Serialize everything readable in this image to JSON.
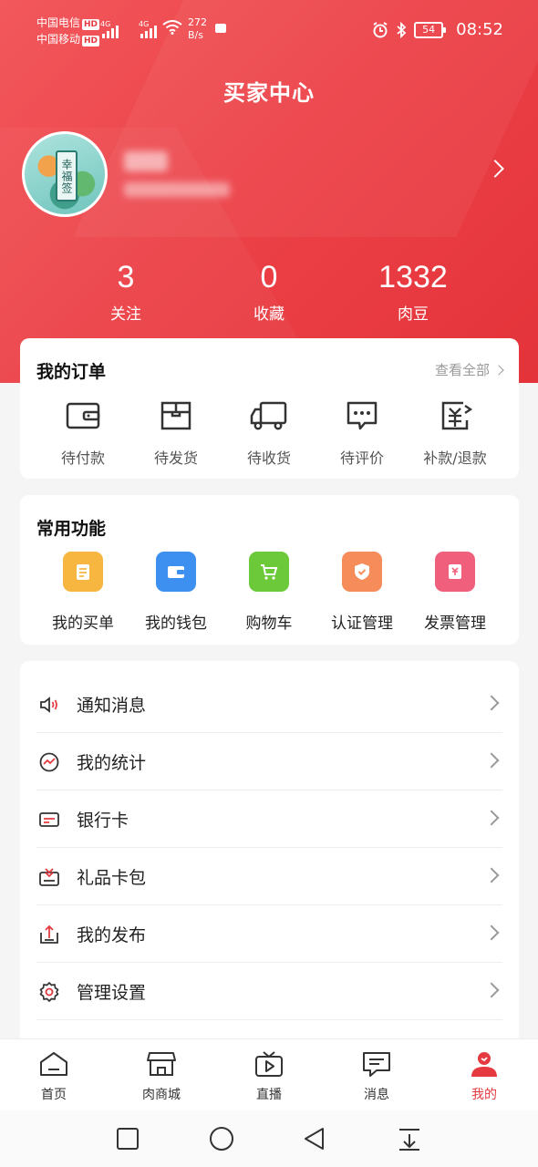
{
  "status_bar": {
    "carrier1": "中国电信",
    "carrier2": "中国移动",
    "hd": "HD",
    "net1": "4G",
    "net2": "4G",
    "speed_value": "272",
    "speed_unit": "B/s",
    "battery": "54",
    "time": "08:52"
  },
  "page": {
    "title": "买家中心"
  },
  "profile": {
    "avatar_text": "幸福签"
  },
  "stats": [
    {
      "value": "3",
      "label": "关注"
    },
    {
      "value": "0",
      "label": "收藏"
    },
    {
      "value": "1332",
      "label": "肉豆"
    }
  ],
  "orders": {
    "title": "我的订单",
    "view_all": "查看全部",
    "items": [
      {
        "label": "待付款",
        "icon": "wallet-icon"
      },
      {
        "label": "待发货",
        "icon": "package-icon"
      },
      {
        "label": "待收货",
        "icon": "truck-icon"
      },
      {
        "label": "待评价",
        "icon": "comment-icon"
      },
      {
        "label": "补款/退款",
        "icon": "refund-icon"
      }
    ]
  },
  "functions": {
    "title": "常用功能",
    "items": [
      {
        "label": "我的买单",
        "icon": "bill-icon",
        "color": "#f7b640"
      },
      {
        "label": "我的钱包",
        "icon": "wallet-icon",
        "color": "#3d8ff0"
      },
      {
        "label": "购物车",
        "icon": "cart-icon",
        "color": "#6cc93a"
      },
      {
        "label": "认证管理",
        "icon": "shield-icon",
        "color": "#f58c5a"
      },
      {
        "label": "发票管理",
        "icon": "invoice-icon",
        "color": "#f0607c"
      }
    ]
  },
  "menu": [
    {
      "label": "通知消息",
      "icon": "speaker-icon"
    },
    {
      "label": "我的统计",
      "icon": "stats-icon"
    },
    {
      "label": "银行卡",
      "icon": "bank-card-icon"
    },
    {
      "label": "礼品卡包",
      "icon": "gift-card-icon"
    },
    {
      "label": "我的发布",
      "icon": "publish-icon"
    },
    {
      "label": "管理设置",
      "icon": "settings-icon"
    }
  ],
  "tabbar": [
    {
      "label": "首页",
      "icon": "home-icon"
    },
    {
      "label": "肉商城",
      "icon": "store-icon"
    },
    {
      "label": "直播",
      "icon": "live-tv-icon"
    },
    {
      "label": "消息",
      "icon": "message-icon"
    },
    {
      "label": "我的",
      "icon": "profile-icon",
      "active": true
    }
  ],
  "colors": {
    "brand": "#e53a40",
    "header_bg": "#ec4248"
  }
}
